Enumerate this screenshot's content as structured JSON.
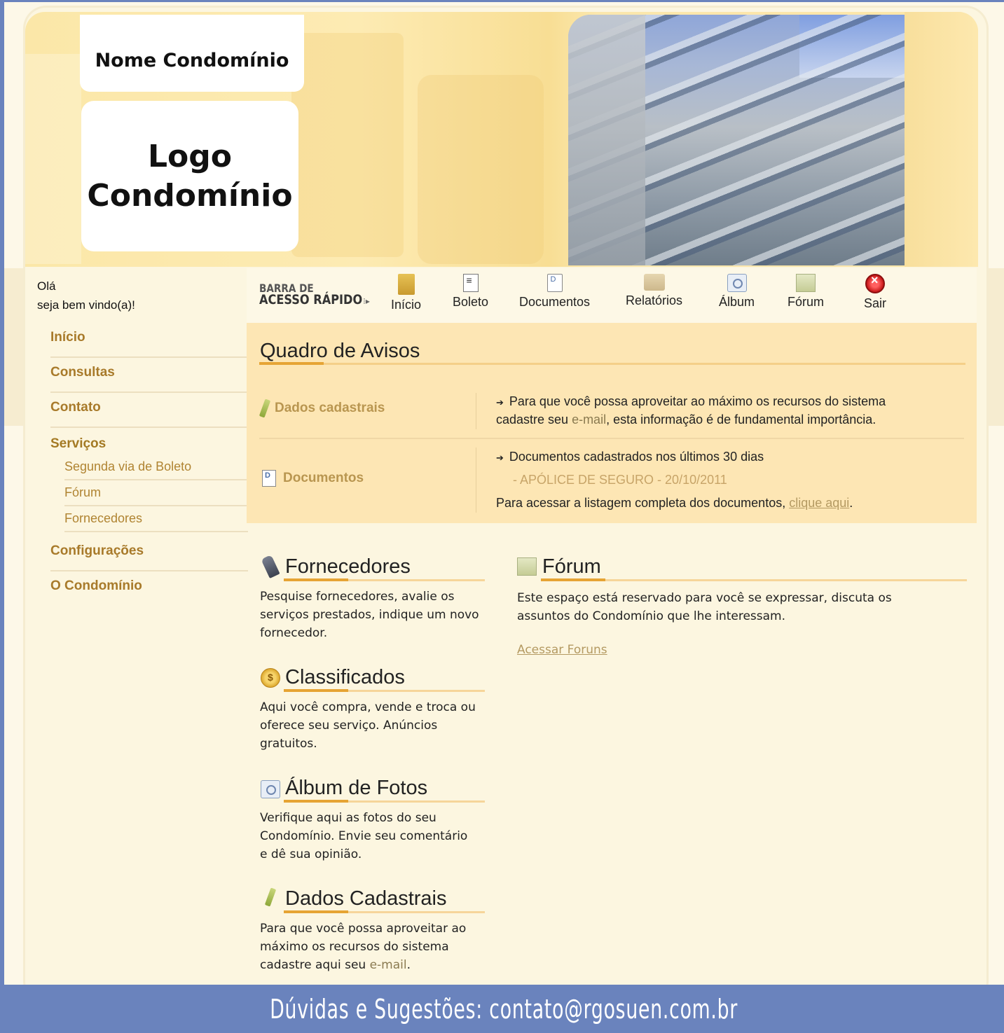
{
  "header": {
    "condo_name": "Nome Condomínio",
    "logo_text": "Logo Condomínio"
  },
  "sidebar": {
    "greeting_line1": "Olá",
    "greeting_line2": "seja bem vindo(a)!",
    "items": [
      {
        "label": "Início"
      },
      {
        "label": "Consultas"
      },
      {
        "label": "Contato"
      }
    ],
    "services": {
      "title": "Serviços",
      "subitems": [
        {
          "label": "Segunda via de Boleto"
        },
        {
          "label": "Fórum"
        },
        {
          "label": "Fornecedores"
        }
      ]
    },
    "items_after": [
      {
        "label": "Configurações"
      },
      {
        "label": "O Condomínio"
      }
    ]
  },
  "quickbar": {
    "label_line1": "BARRA DE",
    "label_line2": "ACESSO RÁPIDO",
    "items": [
      {
        "label": "Início",
        "icon": "home-icon"
      },
      {
        "label": "Boleto",
        "icon": "boleto-icon"
      },
      {
        "label": "Documentos",
        "icon": "document-icon"
      },
      {
        "label": "Relatórios",
        "icon": "folder-icon"
      },
      {
        "label": "Álbum",
        "icon": "camera-icon"
      },
      {
        "label": "Fórum",
        "icon": "forum-icon"
      },
      {
        "label": "Sair",
        "icon": "exit-icon"
      }
    ]
  },
  "avisos": {
    "title": "Quadro de Avisos",
    "row1_label": "Dados cadastrais",
    "row1_text_a": "Para que você possa aproveitar ao máximo os recursos do sistema",
    "row1_text_b_pre": "cadastre seu ",
    "row1_text_b_link": "e-mail",
    "row1_text_b_post": ", esta informação é de fundamental importância.",
    "row2_label": "Documentos",
    "row2_text_a": "Documentos cadastrados nos últimos 30 dias",
    "row2_doc": "- APÓLICE DE SEGURO - 20/10/2011",
    "row2_text_c_pre": "Para acessar a listagem completa dos documentos, ",
    "row2_text_c_link": "clique aqui",
    "row2_text_c_post": "."
  },
  "sections": {
    "fornecedores": {
      "title": "Fornecedores",
      "l1": "Pesquise fornecedores, avalie os",
      "l2": "serviços prestados, indique um novo",
      "l3": "fornecedor."
    },
    "classificados": {
      "title": "Classificados",
      "l1": "Aqui você compra, vende e troca ou",
      "l2": "oferece seu serviço. Anúncios",
      "l3": "gratuitos."
    },
    "album": {
      "title": "Álbum de Fotos",
      "l1": "Verifique aqui as fotos do seu",
      "l2": "Condomínio. Envie seu comentário",
      "l3": "e dê sua opinião."
    },
    "dados": {
      "title": "Dados Cadastrais",
      "l1": "Para que você possa aproveitar ao",
      "l2": "máximo os recursos do sistema",
      "l3_pre": "cadastre aqui seu ",
      "l3_link": "e-mail",
      "l3_post": "."
    },
    "forum": {
      "title": "Fórum",
      "l1": "Este espaço está reservado para você se expressar, discuta os",
      "l2": "assuntos do Condomínio que lhe interessam.",
      "link": "Acessar Foruns"
    }
  },
  "footer": {
    "text": "Dúvidas e Sugestões: contato@rgosuen.com.br"
  },
  "colors": {
    "footer_bg": "#6a83bd",
    "accent": "#e6a434",
    "notice_bg": "#fde6b4",
    "nav_text": "#a87a2a"
  }
}
